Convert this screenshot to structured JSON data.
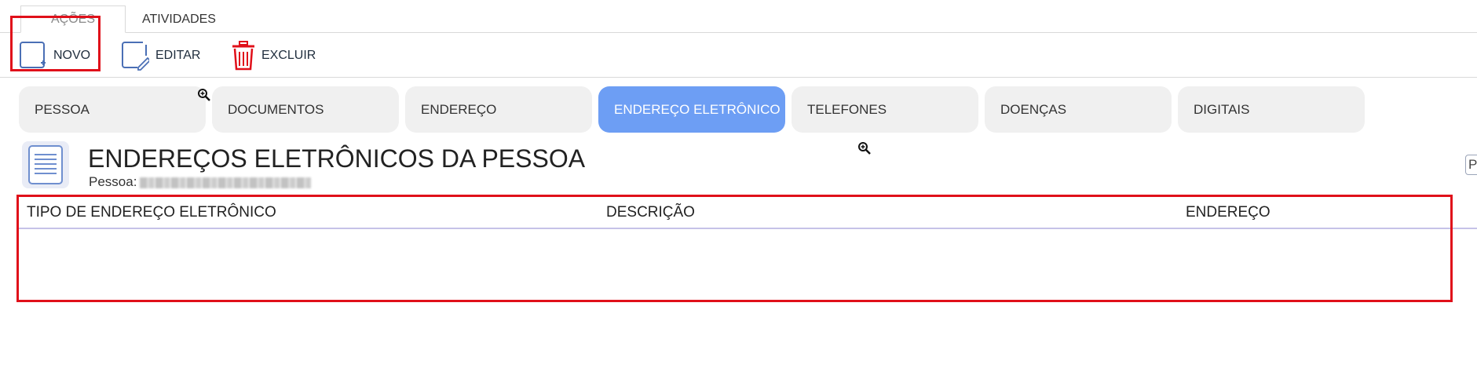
{
  "top_tabs": [
    {
      "label": "AÇÕES",
      "active": true
    },
    {
      "label": "ATIVIDADES",
      "active": false
    }
  ],
  "toolbar": {
    "new_label": "NOVO",
    "edit_label": "EDITAR",
    "delete_label": "EXCLUIR"
  },
  "section_tabs": [
    {
      "label": "PESSOA",
      "active": false
    },
    {
      "label": "DOCUMENTOS",
      "active": false
    },
    {
      "label": "ENDEREÇO",
      "active": false
    },
    {
      "label": "ENDEREÇO ELETRÔNICO",
      "active": true
    },
    {
      "label": "TELEFONES",
      "active": false
    },
    {
      "label": "DOENÇAS",
      "active": false
    },
    {
      "label": "DIGITAIS",
      "active": false
    }
  ],
  "page": {
    "title": "ENDEREÇOS ELETRÔNICOS DA PESSOA",
    "person_label": "Pessoa:",
    "edge_button_label": "P"
  },
  "table": {
    "columns": [
      "TIPO DE ENDEREÇO ELETRÔNICO",
      "DESCRIÇÃO",
      "ENDEREÇO"
    ],
    "rows": []
  },
  "colors": {
    "active_tab": "#6d9ef4",
    "highlight": "#e0101a",
    "delete_icon": "#e0101a",
    "icon_blue": "#4a6fb5"
  }
}
